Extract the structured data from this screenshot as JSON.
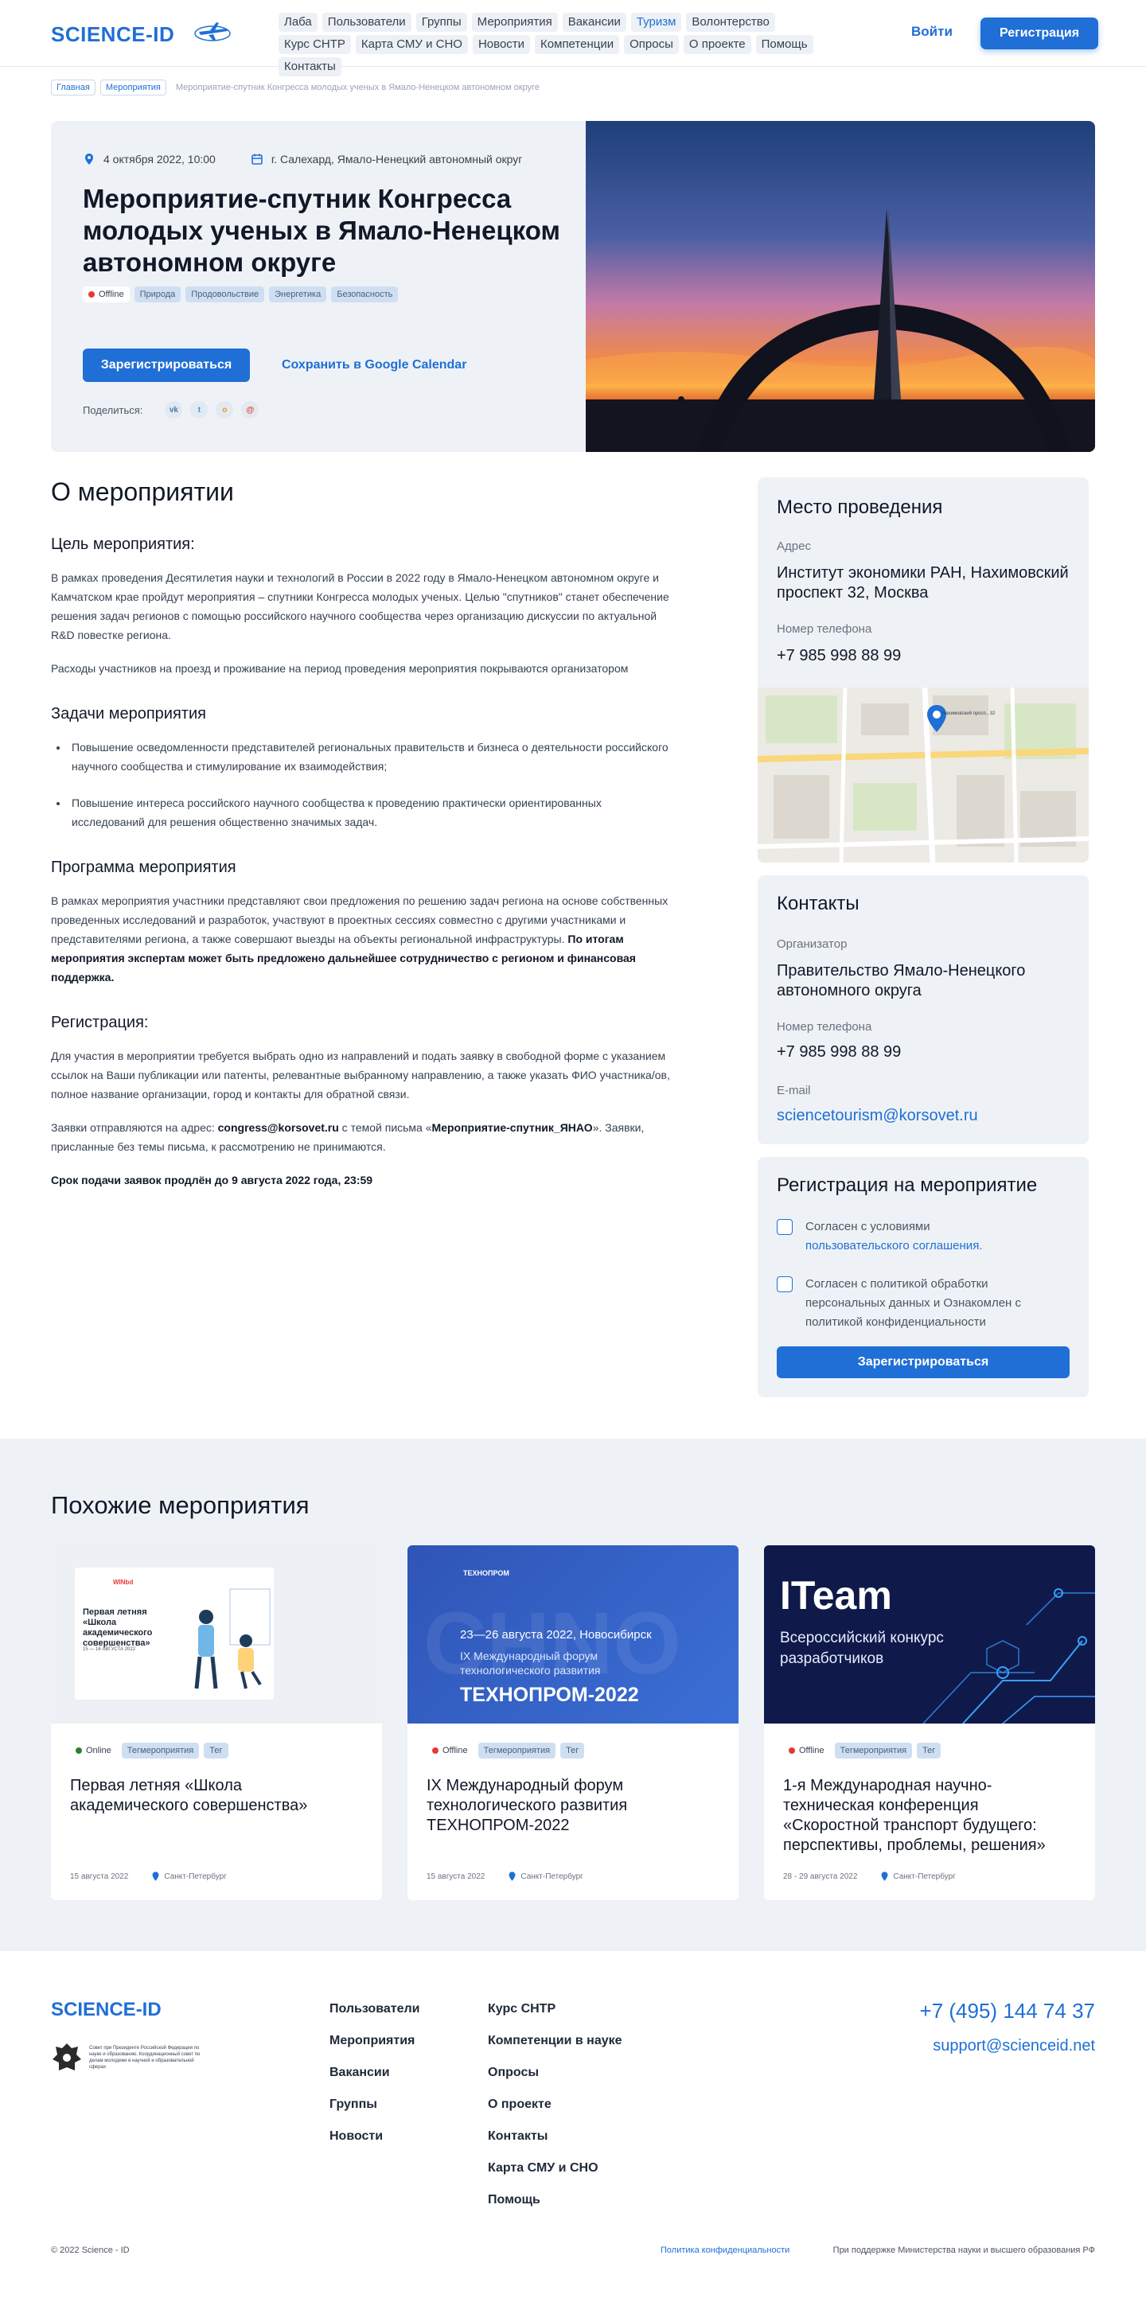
{
  "header": {
    "logo": "SCIENCE-ID",
    "nav": [
      "Лаба",
      "Пользователи",
      "Группы",
      "Мероприятия",
      "Вакансии",
      "Туризм",
      "Волонтерство",
      "Курс СНТР",
      "Карта СМУ и СНО",
      "Новости",
      "Компетенции",
      "Опросы",
      "О проекте",
      "Помощь",
      "Контакты"
    ],
    "active_nav": "Туризм",
    "login": "Войти",
    "register": "Регистрация"
  },
  "breadcrumb": [
    "Главная",
    "Мероприятия",
    "Мероприятие-спутник Конгресса молодых ученых в Ямало-Ненецком автономном округе"
  ],
  "event": {
    "date": "4 октября 2022, 10:00",
    "location": "г. Салехард, Ямало-Ненецкий автономный округ",
    "title": "Мероприятие-спутник Конгресса молодых ученых в Ямало-Ненецком автономном округе",
    "format": "Offline",
    "tags": [
      "Природа",
      "Продовольствие",
      "Энергетика",
      "Безопасность"
    ],
    "register": "Зарегистрироваться",
    "calendar": "Сохранить в Google Calendar",
    "share_label": "Поделиться:",
    "share": [
      "vk",
      "tw",
      "ok",
      "mail"
    ]
  },
  "about": {
    "title": "О мероприятии",
    "goal_h": "Цель мероприятия:",
    "goal_p1": "В рамках проведения Десятилетия науки и технологий в России в 2022 году в Ямало-Ненецком автономном округе и Камчатском крае пройдут мероприятия – спутники Конгресса молодых ученых. Целью \"спутников\" станет обеспечение решения задач регионов с помощью российского научного сообщества через организацию дискуссии по актуальной R&D повестке региона.",
    "goal_p2": "Расходы участников на проезд и проживание на период проведения мероприятия покрываются организатором",
    "tasks_h": "Задачи мероприятия",
    "tasks": [
      "Повышение осведомленности представителей региональных правительств и бизнеса о деятельности российского научного сообщества и стимулирование их взаимодействия;",
      "Повышение интереса российского научного сообщества к проведению практически ориентированных исследований для решения общественно значимых задач."
    ],
    "program_h": "Программа мероприятия",
    "program_p": "В рамках мероприятия участники представляют свои предложения по решению задач региона на основе собственных проведенных исследований и разработок, участвуют в проектных сессиях совместно с другими участниками и представителями региона, а также совершают выезды на объекты региональной инфраструктуры.",
    "program_b": "По итогам мероприятия экспертам может быть предложено дальнейшее сотрудничество с регионом и финансовая поддержка.",
    "reg_h": "Регистрация:",
    "reg_p1": "Для участия в мероприятии требуется выбрать одно из направлений и подать заявку в свободной форме с указанием ссылок на Ваши публикации или патенты, релевантные выбранному направлению, а также указать ФИО участника/ов, полное название организации, город и контакты для обратной связи.",
    "reg_p2a": "Заявки отправляются на адрес: ",
    "reg_email": "congress@korsovet.ru",
    "reg_p2b": " с темой письма «",
    "reg_subject": "Мероприятие-спутник_ЯНАО",
    "reg_p2c": "». Заявки, присланные без темы письма, к рассмотрению не принимаются.",
    "deadline": "Срок подачи заявок продлён до 9 августа 2022 года, 23:59"
  },
  "venue": {
    "title": "Место проведения",
    "address_label": "Адрес",
    "address": "Институт экономики РАН, Нахимовский проспект 32, Москва",
    "phone_label": "Номер телефона",
    "phone": "+7 985 998 88 99",
    "map_label": "Нахимовский просп., 32"
  },
  "contacts": {
    "title": "Контакты",
    "org_label": "Организатор",
    "org": "Правительство Ямало-Ненецкого автономного округа",
    "phone_label": "Номер телефона",
    "phone": "+7 985 998 88 99",
    "email_label": "E-mail",
    "email": "sciencetourism@korsovet.ru"
  },
  "registration": {
    "title": "Регистрация на мероприятие",
    "check1": "Согласен с условиями",
    "check1_link": "пользовательского соглашения.",
    "check2": "Согласен с политикой обработки персональных данных и Ознакомлен с политикой конфиденциальности",
    "button": "Зарегистрироваться"
  },
  "similar": {
    "title": "Похожие мероприятия",
    "events": [
      {
        "format": "Online",
        "tags": [
          "Тегмероприятия",
          "Тег"
        ],
        "title": "Первая летняя «Школа академического совершенства»",
        "date": "15 августа 2022",
        "city": "Санкт-Петербург",
        "img_title": "Первая летняя «Школа академического совершенства»",
        "img_dates": "15 — 16 АВГУСТА 2022",
        "img_org": "WINbd"
      },
      {
        "format": "Offline",
        "tags": [
          "Тегмероприятия",
          "Тег"
        ],
        "title": "IX Международный форум технологического развития ТЕХНОПРОМ-2022",
        "date": "15 августа 2022",
        "city": "Санкт-Петербург",
        "img_dates": "23—26 августа 2022, Новосибирск",
        "img_sub": "IX Международный форум технологического развития",
        "img_big": "ТЕХНОПРОМ-2022",
        "img_logo": "ТЕХНОПРОМ"
      },
      {
        "format": "Offline",
        "tags": [
          "Тегмероприятия",
          "Тег"
        ],
        "title": "1-я Международная научно-техническая конференция «Скоростной транспорт будущего: перспективы, проблемы, решения»",
        "date": "28 - 29 августа 2022",
        "city": "Санкт-Петербург",
        "img_big": "ITeam",
        "img_sub": "Всероссийский конкурс разработчиков"
      }
    ]
  },
  "footer": {
    "logo": "SCIENCE-ID",
    "emblem_text": "Совет при Президенте Российской Федерации по науке и образованию. Координационный совет по делам молодежи в научной и образовательной сферах",
    "col1": [
      "Пользователи",
      "Мероприятия",
      "Вакансии",
      "Группы",
      "Новости"
    ],
    "col2": [
      "Курс СНТР",
      "Компетенции в науке",
      "Опросы",
      "О проекте",
      "Контакты",
      "Карта СМУ и СНО",
      "Помощь"
    ],
    "phone": "+7 (495) 144 74 37",
    "email": "support@scienceid.net",
    "copyright": "© 2022 Science - ID",
    "privacy": "Политика конфиденциальности",
    "support": "При поддержке Министерства науки и высшего образования РФ"
  },
  "colors": {
    "accent": "#1f6fd6",
    "panel": "#eef2f6",
    "offline": "#e53935",
    "online": "#2e7d32"
  }
}
